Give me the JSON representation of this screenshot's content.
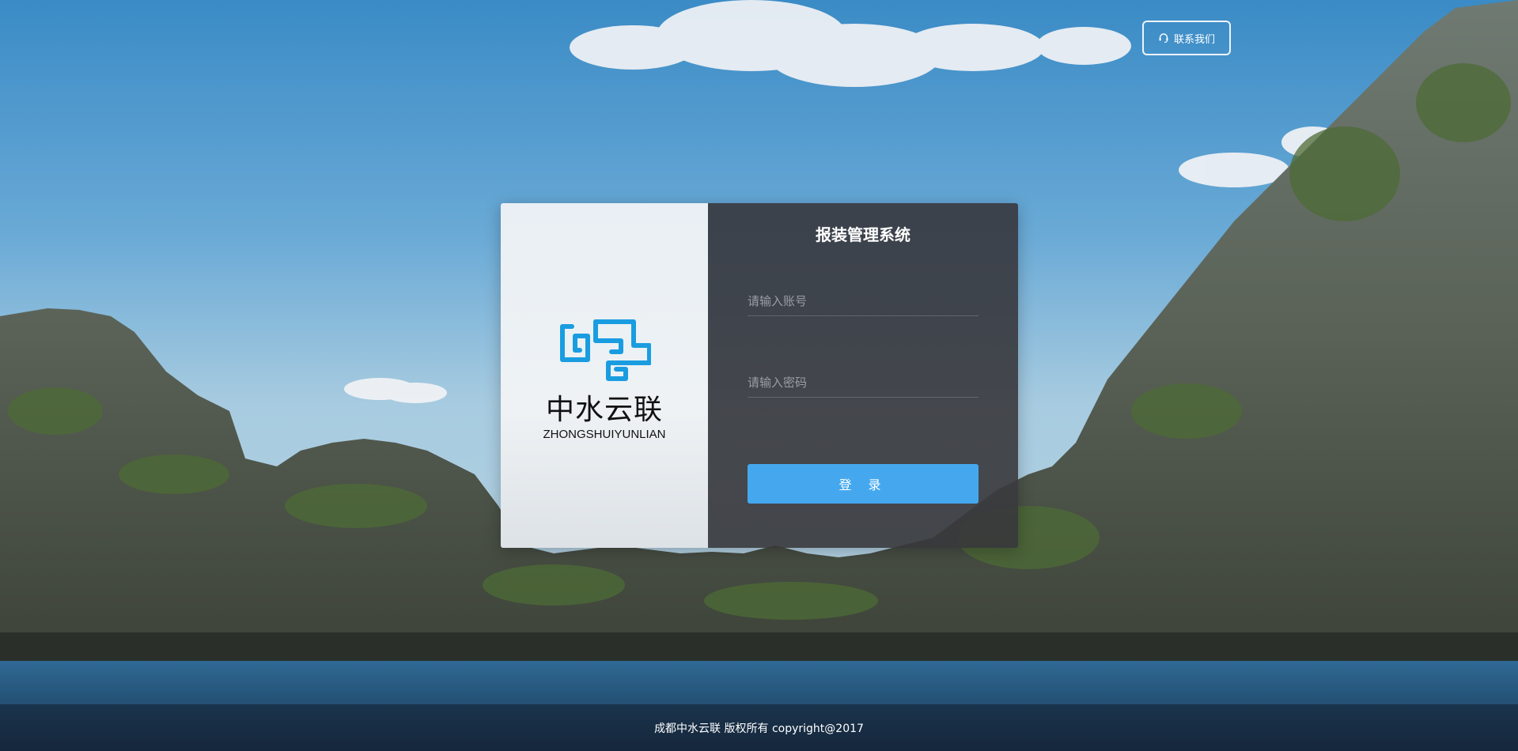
{
  "header": {
    "contact_label": "联系我们",
    "contact_icon": "headset-icon"
  },
  "logo": {
    "name_cn": "中水云联",
    "name_en": "ZHONGSHUIYUNLIAN",
    "brand_color": "#1a9de0"
  },
  "login": {
    "title": "报装管理系统",
    "account_placeholder": "请输入账号",
    "account_value": "",
    "password_placeholder": "请输入密码",
    "password_value": "",
    "submit_label": "登 录",
    "button_color": "#45a8ef"
  },
  "footer": {
    "copyright": "成都中水云联 版权所有 copyright@2017"
  }
}
